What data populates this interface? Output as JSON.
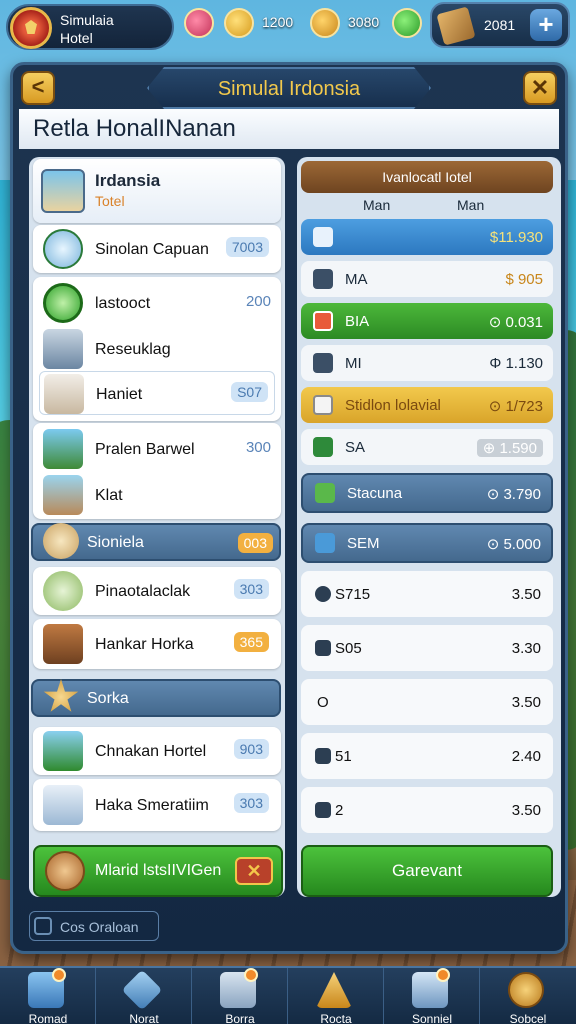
{
  "hud": {
    "badge_line1": "Simulaia",
    "badge_line2": "Hotel",
    "res1": "1200",
    "res2": "3080",
    "res3": "2081",
    "plus": "+"
  },
  "panel": {
    "back": "<",
    "close": "✕",
    "title": "Simulal Irdonsia",
    "subtitle": "Retla HonalINanan"
  },
  "left": {
    "top_card": {
      "name": "Irdansia",
      "sub": "Totel"
    },
    "row1": {
      "name": "Sinolan Capuan",
      "value": "7003"
    },
    "row2": {
      "name": "lastooct",
      "value": "200"
    },
    "row3": {
      "name": "Reseuklag"
    },
    "row4": {
      "name": "Haniet",
      "value": "S07"
    },
    "row5": {
      "name": "Pralen Barwel",
      "value": "300"
    },
    "row6": {
      "name": "Klat"
    },
    "section1": {
      "name": "Sioniela",
      "value": "003"
    },
    "row7": {
      "name": "Pinaotalaclak",
      "value": "303"
    },
    "row8": {
      "name": "Hankar Horka",
      "value": "365"
    },
    "section2": {
      "name": "Sorka"
    },
    "row9": {
      "name": "Chnakan Hortel",
      "value": "903"
    },
    "row10": {
      "name": "Haka Smeratiim",
      "value": "303"
    },
    "action": {
      "name": "Mlarid lstsIIVIGen",
      "x": "✕"
    }
  },
  "right": {
    "header": "Ivanlocatl Iotel",
    "col1": "Man",
    "col2": "Man",
    "rows": [
      {
        "name": "",
        "value": "$11.930"
      },
      {
        "name": "MA",
        "value": "$ 905"
      },
      {
        "name": "BIA",
        "value": "⊙ 0.031"
      },
      {
        "name": "MI",
        "value": "Φ 1.130"
      },
      {
        "name": "Stidlon lolavial",
        "value": "⊙ 1/723"
      },
      {
        "name": "SA",
        "value": "⊕ 1.590"
      },
      {
        "name": "Stacuna",
        "value": "⊙ 3.790"
      },
      {
        "name": "SEM",
        "value": "⊙ 5.000"
      }
    ],
    "list": [
      {
        "name": "S715",
        "value": "3.50"
      },
      {
        "name": "S05",
        "value": "3.30"
      },
      {
        "name": "O",
        "value": "3.50"
      },
      {
        "name": "51",
        "value": "2.40"
      },
      {
        "name": "2",
        "value": "3.50"
      }
    ],
    "action": "Garevant"
  },
  "footer_check": "Cos Oraloan",
  "nav": [
    {
      "label": "Romad"
    },
    {
      "label": "Norat"
    },
    {
      "label": "Borra"
    },
    {
      "label": "Rocta"
    },
    {
      "label": "Sonniel"
    },
    {
      "label": "Sobcel"
    }
  ]
}
